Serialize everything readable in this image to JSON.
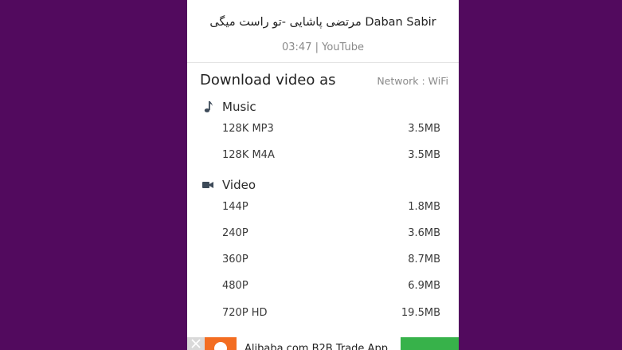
{
  "video": {
    "title": "مرتضی پاشایی -تو راست میگی Daban Sabir",
    "meta": "03:47 | YouTube"
  },
  "dialog": {
    "heading": "Download video as",
    "network": "Network : WiFi"
  },
  "music": {
    "label": "Music",
    "icon": "music-note-icon",
    "options": [
      {
        "format": "128K MP3",
        "size": "3.5MB"
      },
      {
        "format": "128K M4A",
        "size": "3.5MB"
      }
    ]
  },
  "videoSection": {
    "label": "Video",
    "icon": "video-camera-icon",
    "options": [
      {
        "format": "144P",
        "size": "1.8MB"
      },
      {
        "format": "240P",
        "size": "3.6MB"
      },
      {
        "format": "360P",
        "size": "8.7MB"
      },
      {
        "format": "480P",
        "size": "6.9MB"
      },
      {
        "format": "720P HD",
        "size": "19.5MB"
      }
    ]
  },
  "ad": {
    "text": "Alibaba.com B2B Trade App",
    "close_icon": "close-icon",
    "accent": "#f36d21",
    "button_color": "#37b24a"
  },
  "colors": {
    "background": "#520a5e",
    "icon": "#3d4a58"
  }
}
